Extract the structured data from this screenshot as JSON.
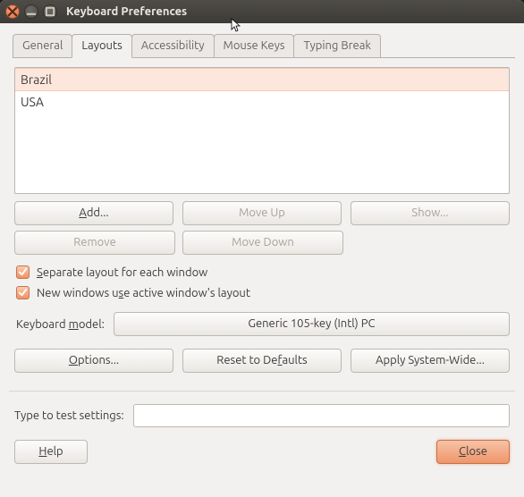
{
  "window": {
    "title": "Keyboard Preferences"
  },
  "tabs": {
    "general": "General",
    "layouts": "Layouts",
    "accessibility": "Accessibility",
    "mouse_keys": "Mouse Keys",
    "typing_break": "Typing Break"
  },
  "layouts": {
    "items": [
      {
        "name": "Brazil",
        "selected": true
      },
      {
        "name": "USA",
        "selected": false
      }
    ],
    "add": "Add...",
    "moveup": "Move Up",
    "show": "Show...",
    "remove": "Remove",
    "movedown": "Move Down"
  },
  "checks": {
    "separate": "Separate layout for each window",
    "new_windows": "New windows use active window's layout"
  },
  "model": {
    "label": "Keyboard model:",
    "value": "Generic 105-key (Intl) PC"
  },
  "actions": {
    "options": "Options...",
    "reset": "Reset to Defaults",
    "apply": "Apply System-Wide..."
  },
  "test": {
    "label": "Type to test settings:",
    "value": ""
  },
  "footer": {
    "help": "Help",
    "close": "Close"
  }
}
